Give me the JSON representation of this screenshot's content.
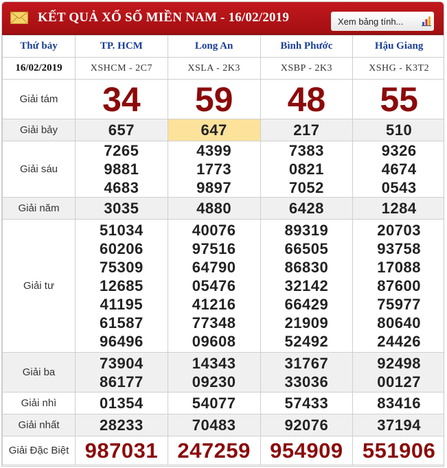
{
  "header": {
    "title": "KẾT QUẢ XỔ SỐ MIỀN NAM - 16/02/2019",
    "view_table_label": "Xem bảng tính..."
  },
  "table": {
    "day_label": "Thứ bảy",
    "date": "16/02/2019",
    "provinces": [
      {
        "name": "TP. HCM",
        "code": "XSHCM - 2C7"
      },
      {
        "name": "Long An",
        "code": "XSLA - 2K3"
      },
      {
        "name": "Bình Phước",
        "code": "XSBP - 2K3"
      },
      {
        "name": "Hậu Giang",
        "code": "XSHG - K3T2"
      }
    ],
    "prizes": {
      "g8": {
        "label": "Giải tám",
        "values": [
          "34",
          "59",
          "48",
          "55"
        ]
      },
      "g7": {
        "label": "Giải bảy",
        "values": [
          "657",
          "647",
          "217",
          "510"
        ]
      },
      "g6": {
        "label": "Giải sáu",
        "values": [
          [
            "7265",
            "9881",
            "4683"
          ],
          [
            "4399",
            "1773",
            "9897"
          ],
          [
            "7383",
            "0821",
            "7052"
          ],
          [
            "9326",
            "4674",
            "0543"
          ]
        ]
      },
      "g5": {
        "label": "Giải năm",
        "values": [
          "3035",
          "4880",
          "6428",
          "1284"
        ]
      },
      "g4": {
        "label": "Giải tư",
        "values": [
          [
            "51034",
            "60206",
            "75309",
            "12685",
            "41195",
            "61587",
            "96496"
          ],
          [
            "40076",
            "97516",
            "64790",
            "05476",
            "41216",
            "77348",
            "09608"
          ],
          [
            "89319",
            "66505",
            "86830",
            "32142",
            "66429",
            "21909",
            "52492"
          ],
          [
            "20703",
            "93758",
            "17088",
            "87600",
            "75977",
            "80640",
            "24426"
          ]
        ]
      },
      "g3": {
        "label": "Giải ba",
        "values": [
          [
            "73904",
            "86177"
          ],
          [
            "14343",
            "09230"
          ],
          [
            "31767",
            "33036"
          ],
          [
            "92498",
            "00127"
          ]
        ]
      },
      "g2": {
        "label": "Giải nhì",
        "values": [
          "01354",
          "54077",
          "57433",
          "83416"
        ]
      },
      "g1": {
        "label": "Giải nhất",
        "values": [
          "28233",
          "70483",
          "92076",
          "37194"
        ]
      },
      "db": {
        "label": "Giải Đặc Biệt",
        "values": [
          "987031",
          "247259",
          "954909",
          "551906"
        ]
      }
    },
    "highlight_color": "#fde29c"
  }
}
